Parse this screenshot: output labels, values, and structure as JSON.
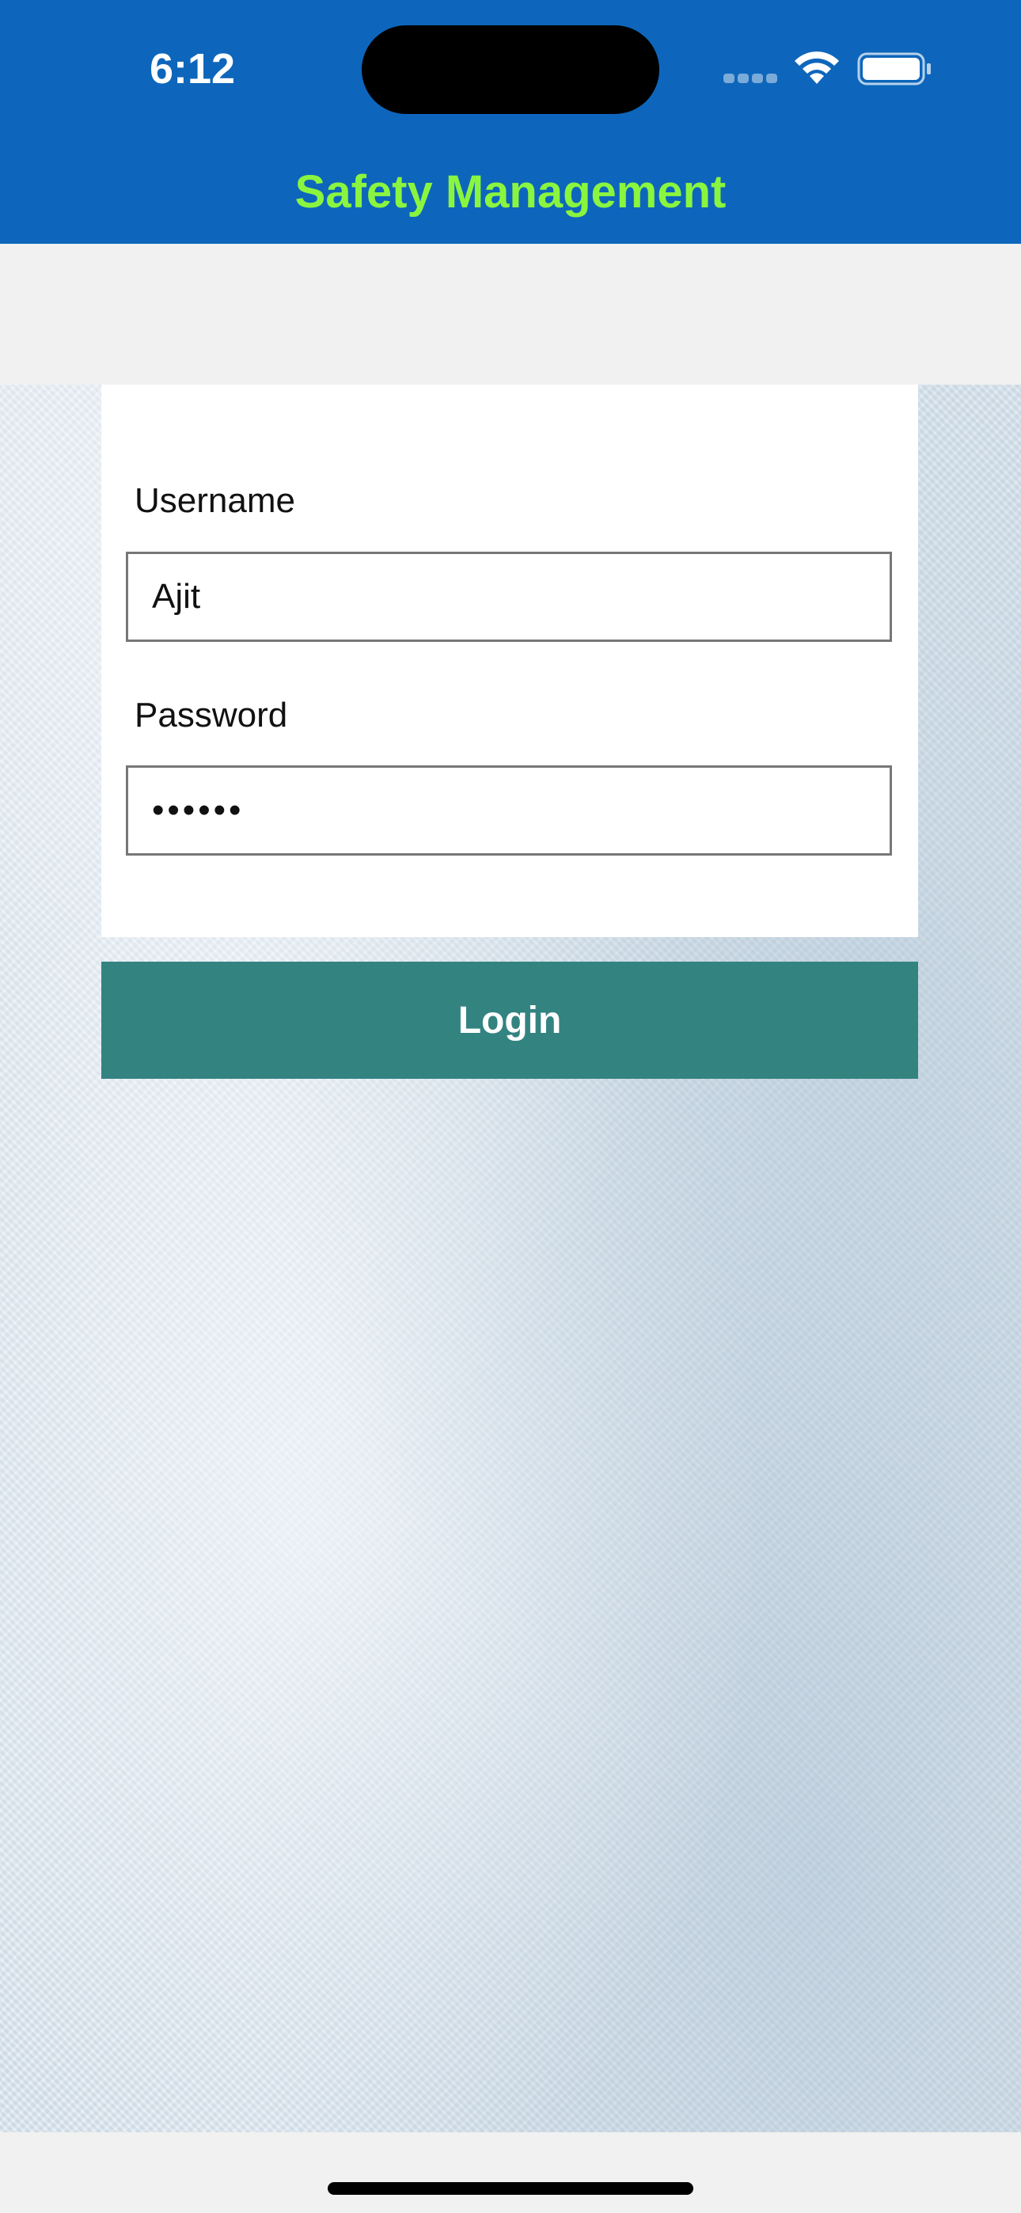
{
  "status_bar": {
    "time": "6:12",
    "icons": [
      "cellular-signal-icon",
      "wifi-icon",
      "battery-icon"
    ]
  },
  "header": {
    "title": "Safety Management",
    "title_color": "#8af53f",
    "background_color": "#0d66bb"
  },
  "form": {
    "username_label": "Username",
    "username_value": "Ajit",
    "password_label": "Password",
    "password_value": "••••••"
  },
  "login_button": {
    "label": "Login",
    "color": "#338381"
  }
}
